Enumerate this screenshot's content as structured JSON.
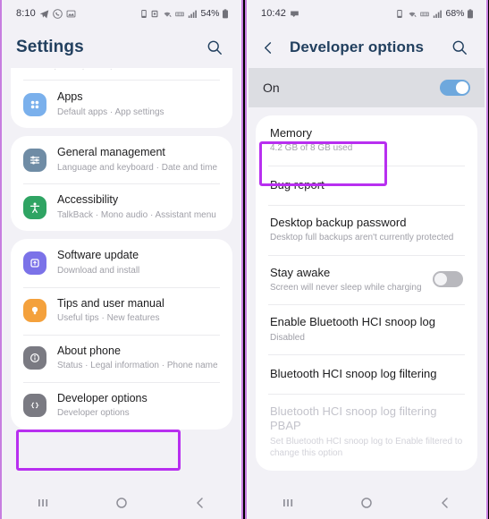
{
  "left": {
    "statusbar": {
      "time": "8:10",
      "left_icons": [
        "telegram-icon",
        "whatsapp-icon",
        "gallery-icon"
      ],
      "right_icons": [
        "alarm-icon",
        "dnd-icon",
        "wifi-icon",
        "signal-bars-icon",
        "network-icon"
      ],
      "battery": "54%"
    },
    "appbar": {
      "title": "Settings",
      "search_icon": "search-icon"
    },
    "groups": [
      {
        "items": [
          {
            "title": "Apps",
            "sub": "Default apps  ·  App settings",
            "icon": "apps-grid-icon",
            "icon_bg": "#7ab0ec"
          }
        ]
      },
      {
        "items": [
          {
            "title": "General management",
            "sub": "Language and keyboard  ·  Date and time",
            "icon": "sliders-icon",
            "icon_bg": "#6f8ca5"
          },
          {
            "title": "Accessibility",
            "sub": "TalkBack  ·  Mono audio  ·  Assistant menu",
            "icon": "accessibility-icon",
            "icon_bg": "#2fa463"
          }
        ]
      },
      {
        "items": [
          {
            "title": "Software update",
            "sub": "Download and install",
            "icon": "software-update-icon",
            "icon_bg": "#7b72e8"
          },
          {
            "title": "Tips and user manual",
            "sub": "Useful tips  ·  New features",
            "icon": "lightbulb-icon",
            "icon_bg": "#f4a13c"
          },
          {
            "title": "About phone",
            "sub": "Status  ·  Legal information  ·  Phone name",
            "icon": "info-icon",
            "icon_bg": "#7a7a82"
          },
          {
            "title": "Developer options",
            "sub": "Developer options",
            "icon": "braces-icon",
            "icon_bg": "#7a7a82"
          }
        ]
      }
    ],
    "navbar": {
      "recents": "recents-icon",
      "home": "home-icon",
      "back": "back-icon"
    }
  },
  "right": {
    "statusbar": {
      "time": "10:42",
      "left_icons": [
        "app-notification-icon"
      ],
      "right_icons": [
        "alarm-icon",
        "wifi-icon",
        "network-icon",
        "signal-bars-icon"
      ],
      "battery": "68%"
    },
    "appbar": {
      "back_icon": "back-chevron-icon",
      "title": "Developer options",
      "search_icon": "search-icon"
    },
    "master_toggle": {
      "label": "On",
      "state": "on"
    },
    "items": [
      {
        "title": "Memory",
        "sub": "4.2 GB of 8 GB used",
        "toggle": null,
        "dim": false
      },
      {
        "title": "Bug report",
        "sub": "",
        "toggle": null,
        "dim": false
      },
      {
        "title": "Desktop backup password",
        "sub": "Desktop full backups aren't currently protected",
        "toggle": null,
        "dim": false
      },
      {
        "title": "Stay awake",
        "sub": "Screen will never sleep while charging",
        "toggle": "off",
        "dim": false
      },
      {
        "title": "Enable Bluetooth HCI snoop log",
        "sub": "Disabled",
        "toggle": null,
        "dim": false
      },
      {
        "title": "Bluetooth HCI snoop log filtering",
        "sub": "",
        "toggle": null,
        "dim": false
      },
      {
        "title": "Bluetooth HCI snoop log filtering PBAP",
        "sub": "Set Bluetooth HCI snoop log to Enable filtered to change this option",
        "toggle": null,
        "dim": true
      }
    ],
    "navbar": {
      "recents": "recents-icon",
      "home": "home-icon",
      "back": "back-icon"
    }
  },
  "annotations": {
    "highlight_color": "#b82ff0",
    "boxes": [
      {
        "name": "developer-options-highlight",
        "target": "Developer options"
      },
      {
        "name": "memory-highlight",
        "target": "Memory"
      }
    ]
  }
}
